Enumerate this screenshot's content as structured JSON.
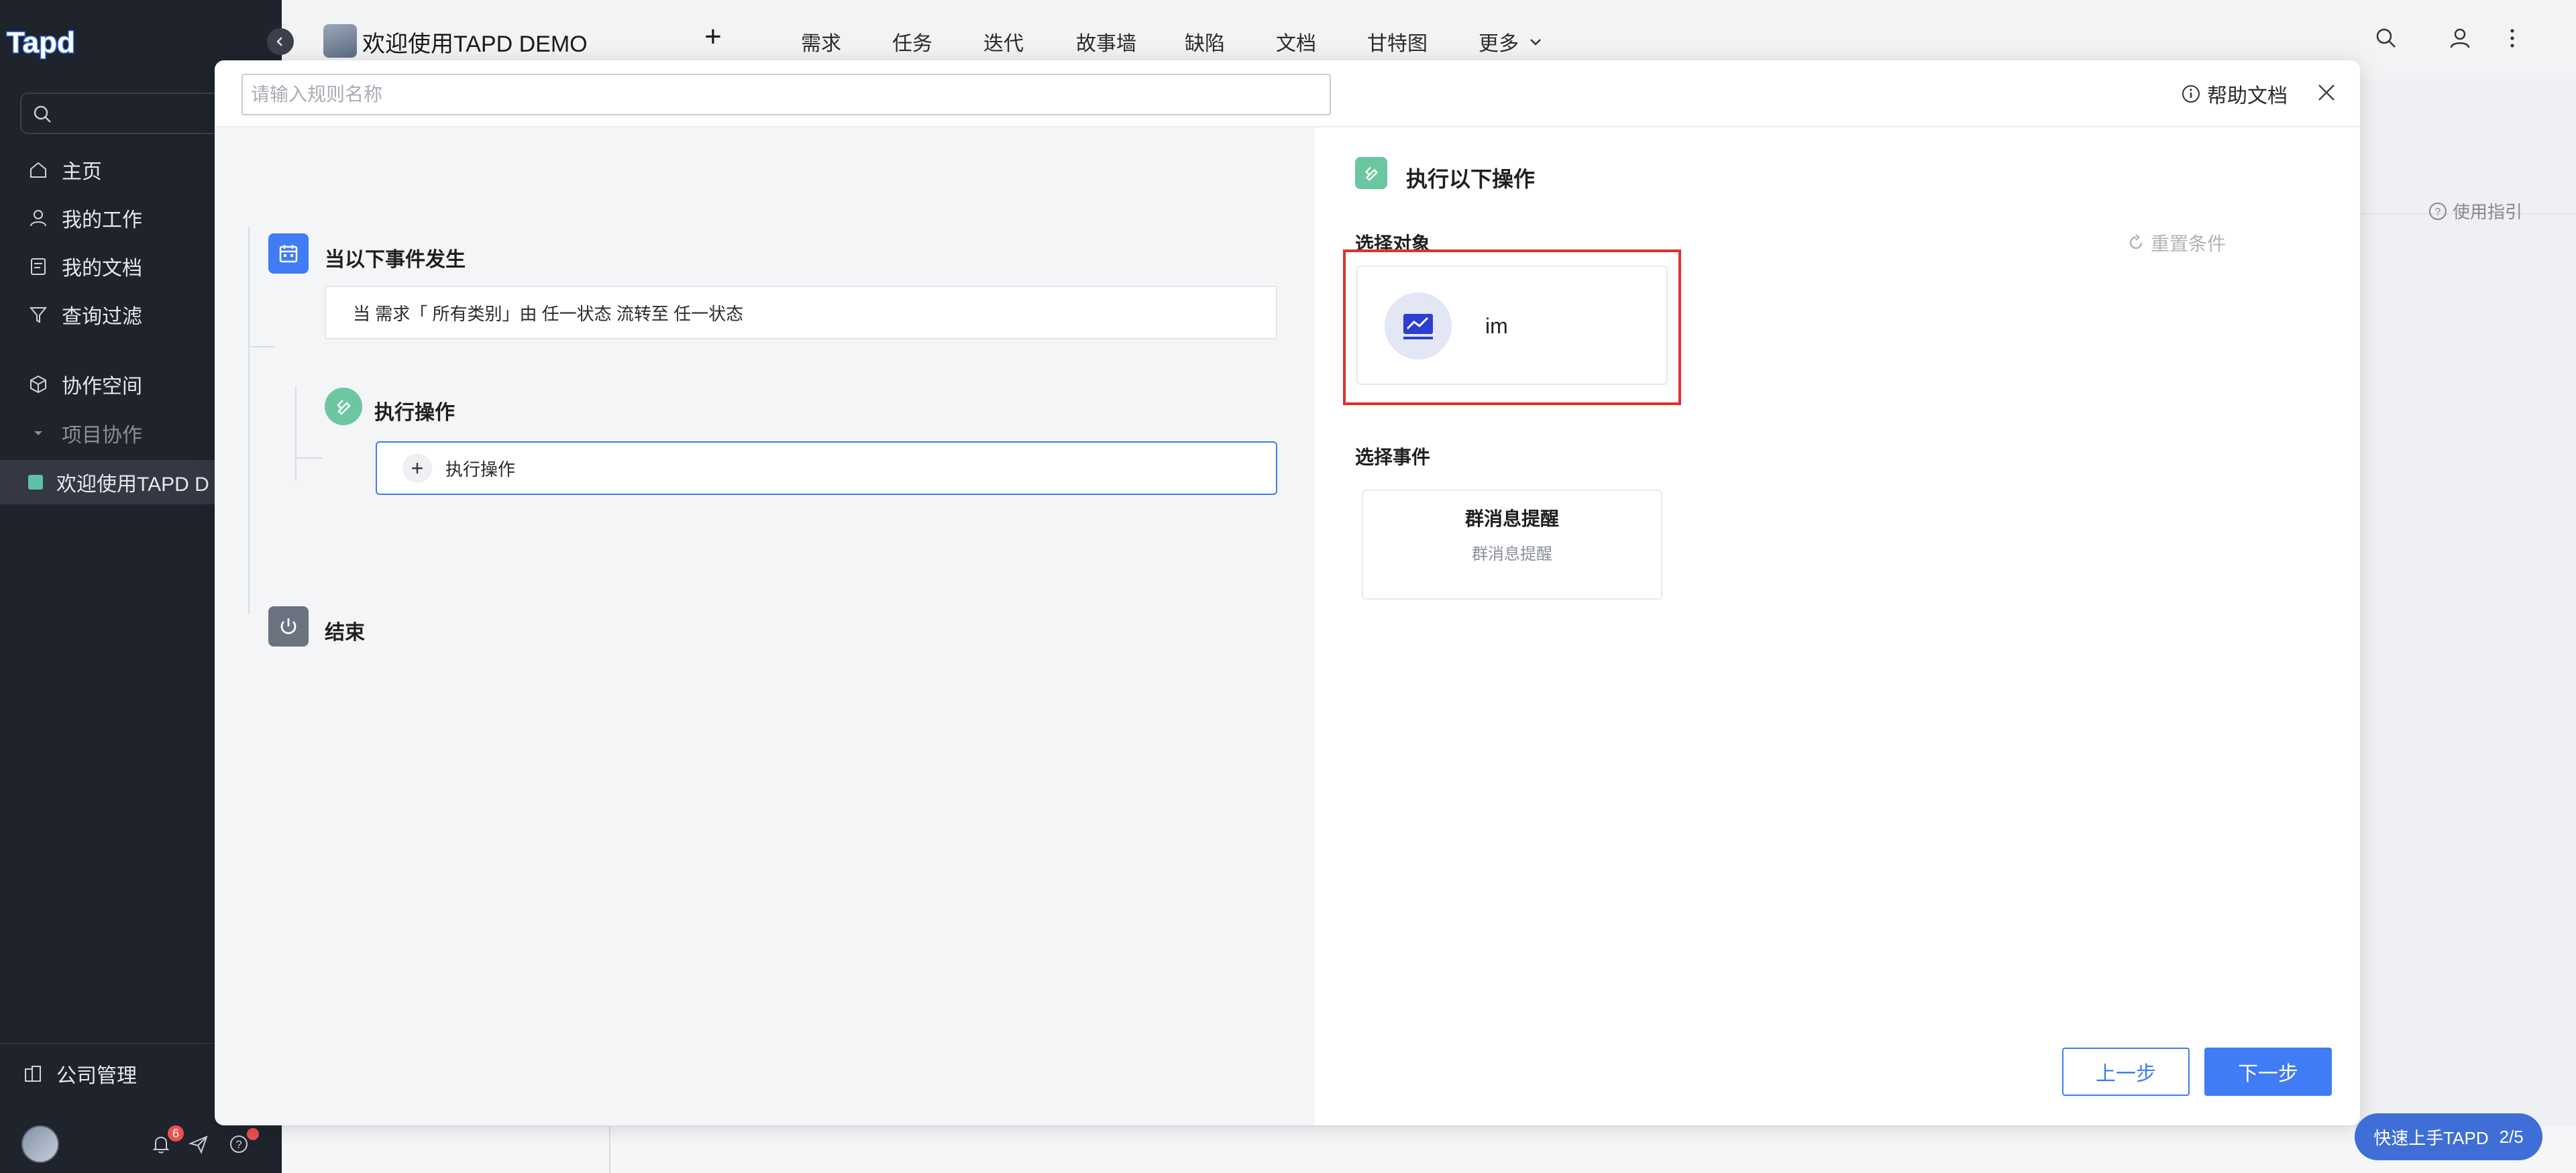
{
  "sidebar": {
    "logo_text": "Tapd",
    "search_placeholder": "",
    "items": [
      {
        "label": "主页",
        "icon": "home-icon"
      },
      {
        "label": "我的工作",
        "icon": "user-icon"
      },
      {
        "label": "我的文档",
        "icon": "document-icon"
      },
      {
        "label": "查询过滤",
        "icon": "filter-icon"
      },
      {
        "label": "协作空间",
        "icon": "cube-icon"
      }
    ],
    "group_label": "项目协作",
    "active_project": "欢迎使用TAPD D",
    "company_admin": "公司管理",
    "notification_count": "6"
  },
  "topbar": {
    "project_title": "欢迎使用TAPD DEMO",
    "add_label": "+",
    "tabs": [
      "需求",
      "任务",
      "迭代",
      "故事墙",
      "缺陷",
      "文档",
      "甘特图",
      "更多"
    ]
  },
  "background": {
    "guide_label": "使用指引"
  },
  "modal": {
    "rule_name_placeholder": "请输入规则名称",
    "help_doc": "帮助文档",
    "flow": {
      "trigger_title": "当以下事件发生",
      "trigger_desc": "当 需求「 所有类别」由 任一状态 流转至 任一状态",
      "action_title": "执行操作",
      "action_add_label": "执行操作",
      "end_title": "结束"
    },
    "right": {
      "title": "执行以下操作",
      "select_object_label": "选择对象",
      "reset_label": "重置条件",
      "object_name": "im",
      "select_event_label": "选择事件",
      "event_title": "群消息提醒",
      "event_desc": "群消息提醒"
    },
    "buttons": {
      "prev": "上一步",
      "next": "下一步"
    }
  },
  "quick_start": {
    "label": "快速上手TAPD",
    "progress": "2/5"
  },
  "colors": {
    "primary": "#3f7cf5",
    "highlight": "#e0312c",
    "sidebar_bg": "#1f232b",
    "action_green": "#6cc6a0"
  }
}
